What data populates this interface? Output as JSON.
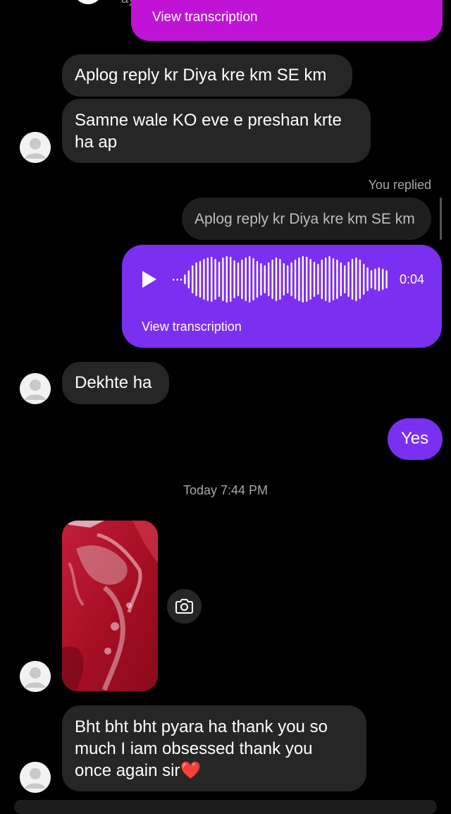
{
  "top": {
    "username_partial": "ayats_aira",
    "transcription_label": "View transcription"
  },
  "messages": {
    "m1": "Aplog reply kr Diya kre km SE km",
    "m2": "Samne wale KO eve e preshan krte ha ap",
    "you_replied_label": "You replied",
    "quoted": "Aplog reply kr Diya kre km SE km",
    "voice": {
      "duration": "0:04",
      "transcription_label": "View transcription"
    },
    "m3": "Dekhte ha",
    "m4": "Yes",
    "timestamp": "Today 7:44 PM",
    "m5": "Bht bht bht pyara ha thank you so much I iam obsessed thank you once again sir",
    "m5_emoji": "❤️"
  },
  "colors": {
    "background": "#000000",
    "incoming_bubble": "#262626",
    "outgoing_bubble": "#7b2ff0",
    "top_voice_bubble": "#c013d6",
    "meta_text": "#a8a8a8"
  }
}
